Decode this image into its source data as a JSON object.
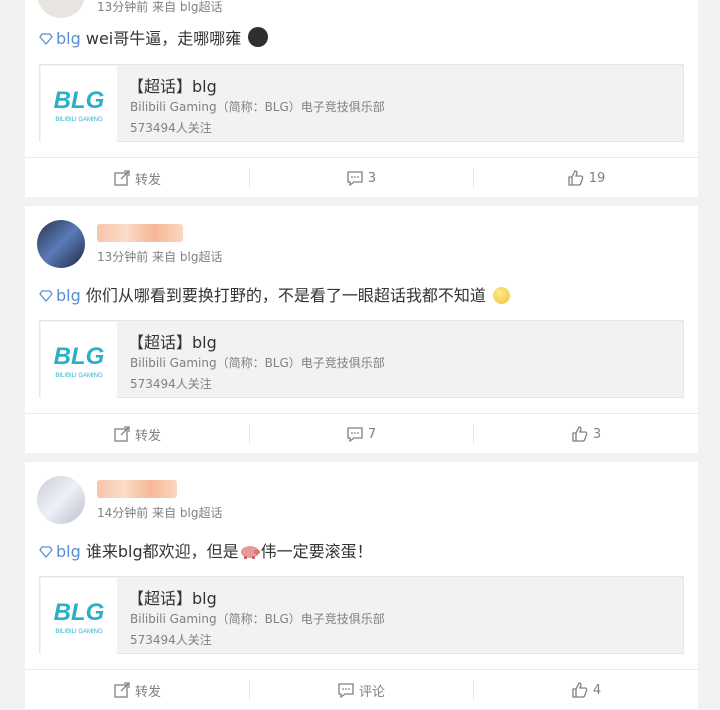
{
  "posts": [
    {
      "meta": "13分钟前 来自 blg超话",
      "tag": "blg",
      "text": "wei哥牛逼，走哪哪雍",
      "topic": {
        "title": "【超话】blg",
        "desc": "Bilibili Gaming（简称：BLG）电子竞技俱乐部",
        "followers": "573494人关注"
      },
      "actions": {
        "repost": "转发",
        "comment": "3",
        "like": "19"
      }
    },
    {
      "meta": "13分钟前 来自 blg超话",
      "tag": "blg",
      "text": "你们从哪看到要换打野的，不是看了一眼超话我都不知道",
      "topic": {
        "title": "【超话】blg",
        "desc": "Bilibili Gaming（简称：BLG）电子竞技俱乐部",
        "followers": "573494人关注"
      },
      "actions": {
        "repost": "转发",
        "comment": "7",
        "like": "3"
      }
    },
    {
      "meta": "14分钟前 来自 blg超话",
      "tag": "blg",
      "text_before": "谁来blg都欢迎，但是",
      "text_after": "伟一定要滚蛋！",
      "topic": {
        "title": "【超话】blg",
        "desc": "Bilibili Gaming（简称：BLG）电子竞技俱乐部",
        "followers": "573494人关注"
      },
      "actions": {
        "repost": "转发",
        "comment": "评论",
        "like": "4"
      }
    }
  ],
  "logo_text": "BLG",
  "logo_subtext": "BILIBILI GAMING",
  "colors": {
    "accent": "#eb7350",
    "link": "#5a8fd8",
    "logo": "#2ab0c8"
  }
}
